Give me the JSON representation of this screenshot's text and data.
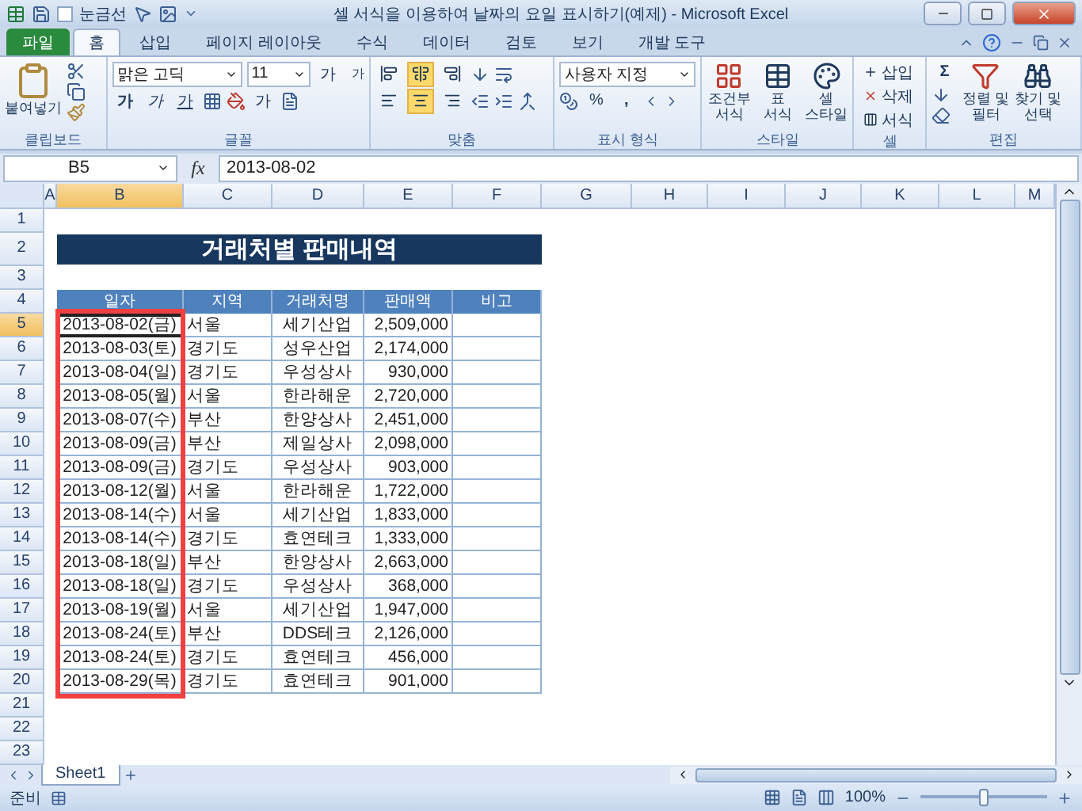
{
  "window": {
    "title": "셀 서식을 이용하여 날짜의 요일 표시하기(예제) - Microsoft Excel"
  },
  "quick_access": {
    "gridlines_label": "눈금선",
    "gridlines_checked": false
  },
  "tabs": [
    {
      "label": "파일",
      "kind": "file",
      "selected": false
    },
    {
      "label": "홈",
      "kind": "tab",
      "selected": true
    },
    {
      "label": "삽입",
      "kind": "tab",
      "selected": false
    },
    {
      "label": "페이지 레이아웃",
      "kind": "tab",
      "selected": false
    },
    {
      "label": "수식",
      "kind": "tab",
      "selected": false
    },
    {
      "label": "데이터",
      "kind": "tab",
      "selected": false
    },
    {
      "label": "검토",
      "kind": "tab",
      "selected": false
    },
    {
      "label": "보기",
      "kind": "tab",
      "selected": false
    },
    {
      "label": "개발 도구",
      "kind": "tab",
      "selected": false
    }
  ],
  "ribbon": {
    "clipboard": {
      "paste": "붙여넣기",
      "label": "클립보드"
    },
    "font": {
      "name": "맑은 고딕",
      "size": "11",
      "grow": "가",
      "shrink": "가",
      "bold": "가",
      "italic": "가",
      "underline": "가",
      "color_letter": "가",
      "label": "글꼴"
    },
    "alignment": {
      "vertical": [
        {
          "selected": false
        },
        {
          "selected": true
        },
        {
          "selected": false
        }
      ],
      "horizontal": [
        {
          "selected": false
        },
        {
          "selected": true
        },
        {
          "selected": false
        }
      ],
      "label": "맞춤"
    },
    "number": {
      "format": "사용자 지정",
      "percent": "%",
      "comma": ",",
      "label": "표시 형식"
    },
    "styles": {
      "buttons": [
        "조건부 서식",
        "표 서식",
        "셀 스타일"
      ],
      "label": "스타일"
    },
    "cells": {
      "buttons": [
        "삽입",
        "삭제",
        "서식"
      ],
      "label": "셀"
    },
    "editing": {
      "sum": "Σ",
      "buttons": [
        "정렬 및 필터",
        "찾기 및 선택"
      ],
      "label": "편집"
    }
  },
  "formula_bar": {
    "name_box": "B5",
    "fx": "fx",
    "value": "2013-08-02"
  },
  "sheet": {
    "columns": [
      {
        "label": "A",
        "selected": false
      },
      {
        "label": "B",
        "selected": true
      },
      {
        "label": "C",
        "selected": false
      },
      {
        "label": "D",
        "selected": false
      },
      {
        "label": "E",
        "selected": false
      },
      {
        "label": "F",
        "selected": false
      },
      {
        "label": "G",
        "selected": false
      },
      {
        "label": "H",
        "selected": false
      },
      {
        "label": "I",
        "selected": false
      },
      {
        "label": "J",
        "selected": false
      },
      {
        "label": "K",
        "selected": false
      },
      {
        "label": "L",
        "selected": false
      },
      {
        "label": "M",
        "selected": false
      }
    ],
    "rows": [
      {
        "label": "1",
        "selected": false
      },
      {
        "label": "2",
        "selected": false
      },
      {
        "label": "3",
        "selected": false
      },
      {
        "label": "4",
        "selected": false
      },
      {
        "label": "5",
        "selected": true
      },
      {
        "label": "6",
        "selected": false
      },
      {
        "label": "7",
        "selected": false
      },
      {
        "label": "8",
        "selected": false
      },
      {
        "label": "9",
        "selected": false
      },
      {
        "label": "10",
        "selected": false
      },
      {
        "label": "11",
        "selected": false
      },
      {
        "label": "12",
        "selected": false
      },
      {
        "label": "13",
        "selected": false
      },
      {
        "label": "14",
        "selected": false
      },
      {
        "label": "15",
        "selected": false
      },
      {
        "label": "16",
        "selected": false
      },
      {
        "label": "17",
        "selected": false
      },
      {
        "label": "18",
        "selected": false
      },
      {
        "label": "19",
        "selected": false
      },
      {
        "label": "20",
        "selected": false
      },
      {
        "label": "21",
        "selected": false
      },
      {
        "label": "22",
        "selected": false
      },
      {
        "label": "23",
        "selected": false
      }
    ],
    "title": "거래처별 판매내역",
    "headers": [
      "일자",
      "지역",
      "거래처명",
      "판매액",
      "비고"
    ],
    "records": [
      {
        "date": "2013-08-02(금)",
        "region": "서울",
        "vendor": "세기산업",
        "amount": "2,509,000",
        "selected": true
      },
      {
        "date": "2013-08-03(토)",
        "region": "경기도",
        "vendor": "성우산업",
        "amount": "2,174,000",
        "selected": false
      },
      {
        "date": "2013-08-04(일)",
        "region": "경기도",
        "vendor": "우성상사",
        "amount": "930,000",
        "selected": false
      },
      {
        "date": "2013-08-05(월)",
        "region": "서울",
        "vendor": "한라해운",
        "amount": "2,720,000",
        "selected": false
      },
      {
        "date": "2013-08-07(수)",
        "region": "부산",
        "vendor": "한양상사",
        "amount": "2,451,000",
        "selected": false
      },
      {
        "date": "2013-08-09(금)",
        "region": "부산",
        "vendor": "제일상사",
        "amount": "2,098,000",
        "selected": false
      },
      {
        "date": "2013-08-09(금)",
        "region": "경기도",
        "vendor": "우성상사",
        "amount": "903,000",
        "selected": false
      },
      {
        "date": "2013-08-12(월)",
        "region": "서울",
        "vendor": "한라해운",
        "amount": "1,722,000",
        "selected": false
      },
      {
        "date": "2013-08-14(수)",
        "region": "서울",
        "vendor": "세기산업",
        "amount": "1,833,000",
        "selected": false
      },
      {
        "date": "2013-08-14(수)",
        "region": "경기도",
        "vendor": "효연테크",
        "amount": "1,333,000",
        "selected": false
      },
      {
        "date": "2013-08-18(일)",
        "region": "부산",
        "vendor": "한양상사",
        "amount": "2,663,000",
        "selected": false
      },
      {
        "date": "2013-08-18(일)",
        "region": "경기도",
        "vendor": "우성상사",
        "amount": "368,000",
        "selected": false
      },
      {
        "date": "2013-08-19(월)",
        "region": "서울",
        "vendor": "세기산업",
        "amount": "1,947,000",
        "selected": false
      },
      {
        "date": "2013-08-24(토)",
        "region": "부산",
        "vendor": "DDS테크",
        "amount": "2,126,000",
        "selected": false
      },
      {
        "date": "2013-08-24(토)",
        "region": "경기도",
        "vendor": "효연테크",
        "amount": "456,000",
        "selected": false
      },
      {
        "date": "2013-08-29(목)",
        "region": "경기도",
        "vendor": "효연테크",
        "amount": "901,000",
        "selected": false
      }
    ]
  },
  "sheet_tabs": [
    {
      "label": "Sheet1",
      "selected": true
    }
  ],
  "status_bar": {
    "mode": "준비",
    "zoom": {
      "reading": "100%",
      "level": 0.5
    }
  }
}
